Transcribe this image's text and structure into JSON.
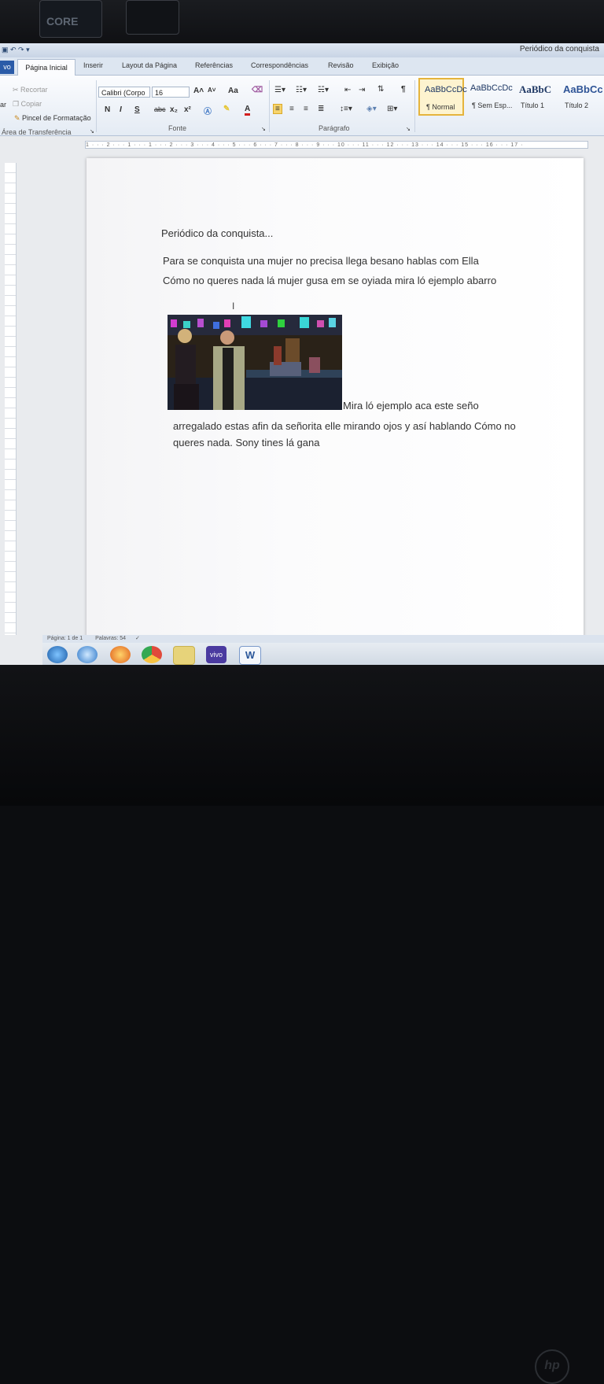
{
  "window": {
    "title": "Periódico da conquista"
  },
  "tabs": {
    "file": "vo",
    "active": "Página Inicial",
    "items": [
      "Inserir",
      "Layout da Página",
      "Referências",
      "Correspondências",
      "Revisão",
      "Exibição"
    ]
  },
  "clipboard": {
    "paste": "ar",
    "cut": "Recortar",
    "copy": "Copiar",
    "format_painter": "Pincel de Formatação",
    "group": "Área de Transferência"
  },
  "font": {
    "name": "Calibri (Corpo",
    "size": "16",
    "group": "Fonte",
    "bold": "N",
    "italic": "I",
    "underline": "S",
    "strike": "abc",
    "sub": "x₂",
    "sup": "x²",
    "grow": "A˄",
    "shrink": "A˅",
    "case": "Aa",
    "color_a": "A"
  },
  "paragraph": {
    "group": "Parágrafo",
    "show_marks": "¶"
  },
  "styles": [
    {
      "preview": "AaBbCcDc",
      "name": "¶ Normal"
    },
    {
      "preview": "AaBbCcDc",
      "name": "¶ Sem Esp..."
    },
    {
      "preview": "AaBbC",
      "name": "Título 1"
    },
    {
      "preview": "AaBbCc",
      "name": "Título 2"
    }
  ],
  "ruler": {
    "text": "1 · · · 2 · · · 1 · · · 1 · · · 2 · · · 3 · · · 4 · · · 5 · · · 6 · · · 7 · · · 8 · · · 9 · · · 10 · · · 11 · · · 12 · · · 13 · · · 14 · · · 15 · · · 16 · · · 17 ·"
  },
  "document": {
    "title": "Periódico da conquista...",
    "paragraph1": "Para se conquista una mujer no precisa llega besano hablas com Ella Cómo no queres nada lá mujer gusa em se oyiada mira ló ejemplo abarro",
    "paragraph2_first": "Mira ló ejemplo aca este seño",
    "paragraph2_rest": "arregalado estas afin da señorita elle mirando ojos y así hablando Cómo no queres nada. Sony tines lá gana"
  },
  "status": {
    "page": "Página: 1 de 1",
    "words": "Palavras: 54"
  },
  "taskbar": {
    "vivo": "vivo",
    "word": "W"
  },
  "hardware": {
    "sticker": "CORE",
    "logo": "hp"
  }
}
